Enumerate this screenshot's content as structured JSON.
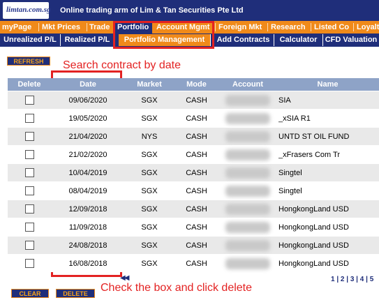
{
  "header": {
    "logo_text": "limtan.com.sg",
    "tagline": "Online trading arm of Lim & Tan Securities Pte Ltd"
  },
  "nav_primary": [
    {
      "label": "myPage",
      "active": false
    },
    {
      "label": "Mkt Prices",
      "active": false
    },
    {
      "label": "Trade",
      "active": false
    },
    {
      "label": "Portfolio",
      "active": true
    },
    {
      "label": "Account Mgmt",
      "active": false
    },
    {
      "label": "Foreign Mkt",
      "active": false
    },
    {
      "label": "Research",
      "active": false
    },
    {
      "label": "Listed Co",
      "active": false
    },
    {
      "label": "Loyalty",
      "active": false
    }
  ],
  "nav_secondary": [
    {
      "label": "Unrealized P/L",
      "active": false
    },
    {
      "label": "Realized P/L",
      "active": false
    },
    {
      "label": "Portfolio Management",
      "active": true
    },
    {
      "label": "Add Contracts",
      "active": false
    },
    {
      "label": "Calculator",
      "active": false
    },
    {
      "label": "CFD Valuation",
      "active": false
    }
  ],
  "buttons": {
    "refresh": "REFRESH",
    "clear": "CLEAR",
    "delete": "DELETE"
  },
  "annotations": {
    "search_note": "Search contract by date",
    "delete_note": "Check the box and click delete"
  },
  "table": {
    "columns": [
      "Delete",
      "Date",
      "Market",
      "Mode",
      "Account",
      "Name"
    ],
    "rows": [
      {
        "date": "09/06/2020",
        "market": "SGX",
        "mode": "CASH",
        "name": "SIA"
      },
      {
        "date": "19/05/2020",
        "market": "SGX",
        "mode": "CASH",
        "name": "_xSIA R1"
      },
      {
        "date": "21/04/2020",
        "market": "NYS",
        "mode": "CASH",
        "name": "UNTD ST OIL FUND"
      },
      {
        "date": "21/02/2020",
        "market": "SGX",
        "mode": "CASH",
        "name": "_xFrasers Com Tr"
      },
      {
        "date": "10/04/2019",
        "market": "SGX",
        "mode": "CASH",
        "name": "Singtel"
      },
      {
        "date": "08/04/2019",
        "market": "SGX",
        "mode": "CASH",
        "name": "Singtel"
      },
      {
        "date": "12/09/2018",
        "market": "SGX",
        "mode": "CASH",
        "name": "HongkongLand USD"
      },
      {
        "date": "11/09/2018",
        "market": "SGX",
        "mode": "CASH",
        "name": "HongkongLand USD"
      },
      {
        "date": "24/08/2018",
        "market": "SGX",
        "mode": "CASH",
        "name": "HongkongLand USD"
      },
      {
        "date": "16/08/2018",
        "market": "SGX",
        "mode": "CASH",
        "name": "HongkongLand USD"
      }
    ]
  },
  "pagination": {
    "prev_icon": "double-left-arrow-icon",
    "pages": [
      "1",
      "2",
      "3",
      "4",
      "5"
    ],
    "current_page": "1"
  },
  "colors": {
    "header_navy": "#1f2e7a",
    "nav_orange": "#f08a1a",
    "annotation_red": "#e32222",
    "table_header": "#8ea3c7"
  }
}
